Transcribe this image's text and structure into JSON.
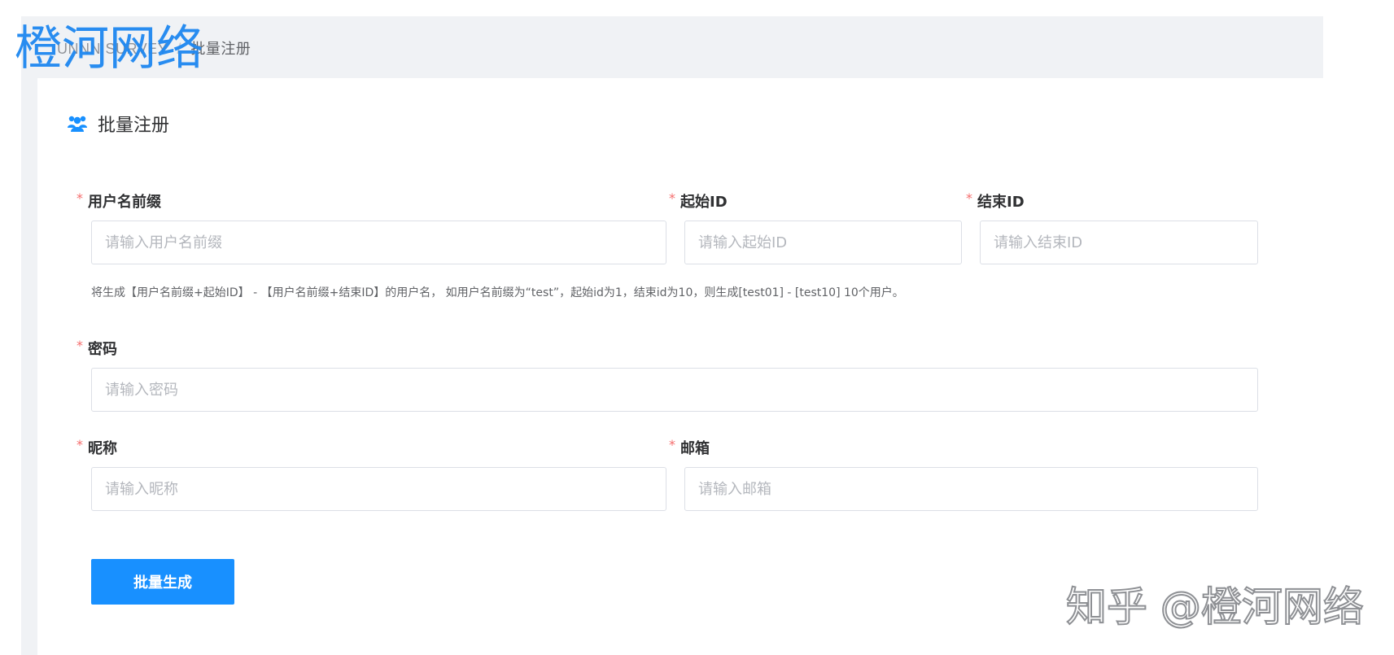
{
  "watermarks": {
    "top_left": "橙河网络",
    "bottom_right": "知乎 @橙河网络"
  },
  "breadcrumb": {
    "root": "UNNN SURVEY",
    "separator": "/",
    "current": "批量注册"
  },
  "section": {
    "title": "批量注册",
    "icon": "users-icon"
  },
  "form": {
    "required_mark": "*",
    "prefix": {
      "label": "用户名前缀",
      "placeholder": "请输入用户名前缀",
      "value": ""
    },
    "start_id": {
      "label": "起始ID",
      "placeholder": "请输入起始ID",
      "value": ""
    },
    "end_id": {
      "label": "结束ID",
      "placeholder": "请输入结束ID",
      "value": ""
    },
    "hint": "将生成【用户名前缀+起始ID】 - 【用户名前缀+结束ID】的用户名， 如用户名前缀为“test”，起始id为1，结束id为10，则生成[test01] - [test10] 10个用户。",
    "password": {
      "label": "密码",
      "placeholder": "请输入密码",
      "value": ""
    },
    "nickname": {
      "label": "昵称",
      "placeholder": "请输入昵称",
      "value": ""
    },
    "email": {
      "label": "邮箱",
      "placeholder": "请输入邮箱",
      "value": ""
    },
    "submit_label": "批量生成"
  },
  "colors": {
    "accent": "#1890ff",
    "required": "#f56c6c",
    "watermark": "#1e87f0"
  }
}
